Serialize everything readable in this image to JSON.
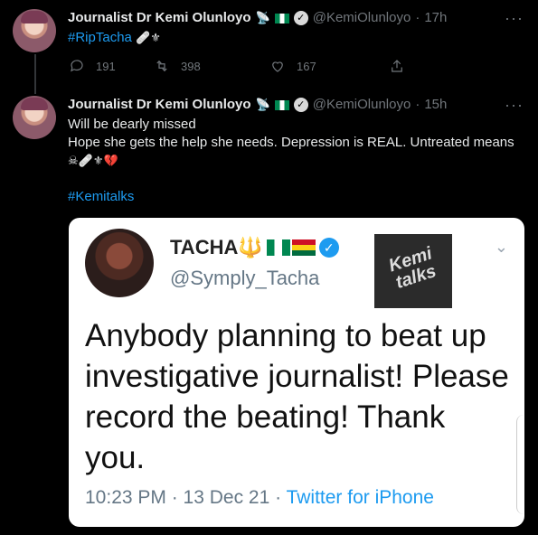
{
  "tweet1": {
    "author": "Journalist Dr Kemi Olunloyo",
    "handle": "@KemiOlunloyo",
    "separator": "·",
    "time": "17h",
    "hashtag": "#RipTacha",
    "emojis": "🩹⚜",
    "replies": "191",
    "retweets": "398",
    "likes": "167"
  },
  "tweet2": {
    "author": "Journalist Dr Kemi Olunloyo",
    "handle": "@KemiOlunloyo",
    "separator": "·",
    "time": "15h",
    "line1": "Will be dearly missed",
    "line2": "Hope she gets the help she needs. Depression is REAL. Untreated means",
    "line3": "☠🩹⚜💔",
    "hashtag": "#Kemitalks"
  },
  "embedded": {
    "name": "TACHA",
    "handle": "@Symply_Tacha",
    "logo_line1": "Kemi",
    "logo_line2": "talks",
    "text": "Anybody planning to beat up investigative journalist! Please record the beating! Thank you.",
    "time": "10:23 PM · 13 Dec 21 · ",
    "source": "Twitter for iPhone"
  },
  "icons": {
    "satellite": "📡",
    "verified": "✓",
    "more": "···",
    "chevron": "⌄",
    "trident": "🔱"
  },
  "colors": {
    "background": "#000000",
    "link": "#1d9bf0",
    "muted": "#71767b"
  }
}
